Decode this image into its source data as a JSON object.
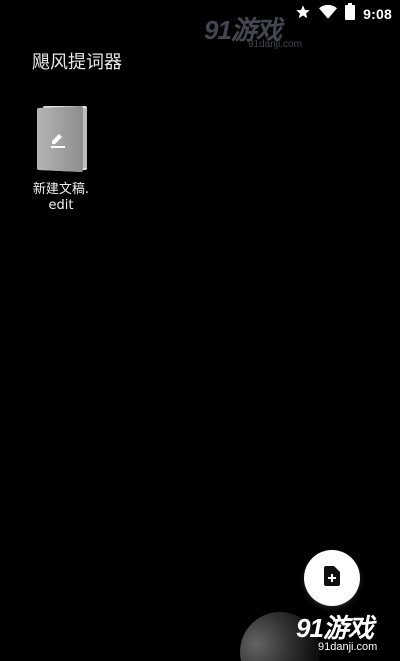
{
  "status_bar": {
    "time": "9:08",
    "icons": [
      "star-icon",
      "wifi-icon",
      "battery-icon"
    ]
  },
  "watermark_top": {
    "brand": "91游戏",
    "url": "91danji.com"
  },
  "app": {
    "title": "飓风提词器"
  },
  "files": [
    {
      "name": "新建文稿.edit",
      "icon": "document-edit-icon"
    }
  ],
  "fab": {
    "icon": "add-document-icon"
  },
  "watermark_bottom": {
    "brand": "91游戏",
    "url": "91danji.com"
  },
  "colors": {
    "background": "#000000",
    "text": "#ffffff",
    "fab": "#ffffff",
    "file_icon": "#c8c8c8"
  }
}
